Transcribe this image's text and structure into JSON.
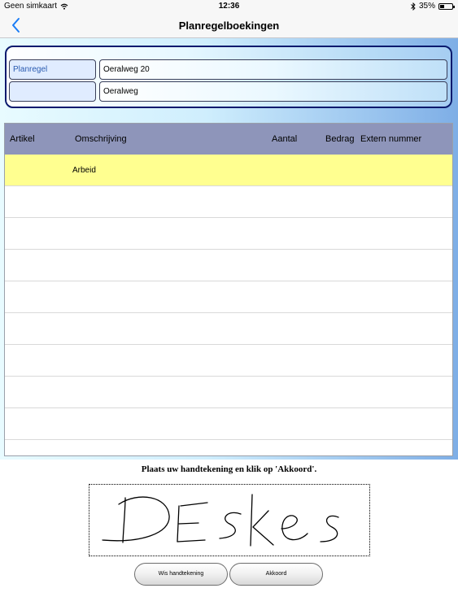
{
  "statusbar": {
    "carrier": "Geen simkaart",
    "time": "12:36",
    "battery": "35%",
    "battery_level": 0.35,
    "icons": [
      "wifi-icon",
      "bluetooth-icon",
      "battery-icon"
    ]
  },
  "navbar": {
    "title": "Planregelboekingen",
    "back_icon": "chevron-left-icon",
    "accent": "#1a7cf5"
  },
  "header": {
    "planregel_label": "Planregel",
    "planregel_value": "Oeralweg 20",
    "second_label": "",
    "second_value": "Oeralweg"
  },
  "table": {
    "columns": [
      "Artikel",
      "Omschrijving",
      "Aantal",
      "Bedrag",
      "Extern nummer"
    ],
    "rows": [
      {
        "artikel": "",
        "omschrijving": "Arbeid",
        "aantal": "",
        "bedrag": "",
        "extern": ""
      }
    ],
    "selected_color": "#ffff90",
    "header_color": "#8e95ba"
  },
  "signature": {
    "instruction": "Plaats uw handtekening en klik op 'Akkoord'.",
    "drawn_text": "DEskes"
  },
  "buttons": {
    "clear_label": "Wis handtekening",
    "accept_label": "Akkoord"
  }
}
